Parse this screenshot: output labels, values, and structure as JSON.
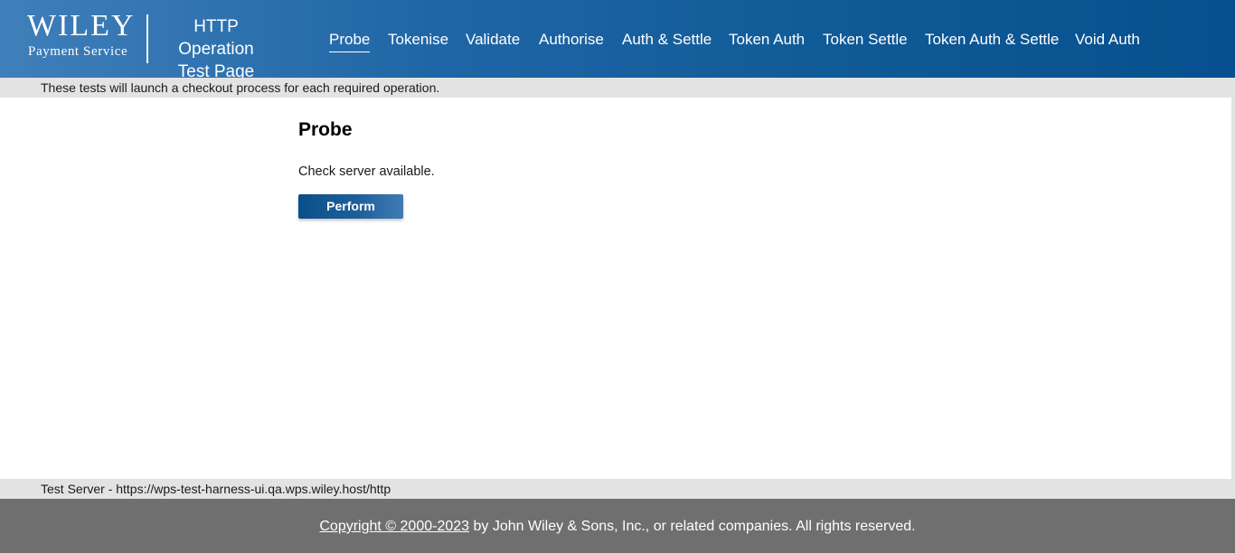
{
  "header": {
    "logo": {
      "brand": "WILEY",
      "subtitle": "Payment Service"
    },
    "page_heading_line1": "HTTP Operation",
    "page_heading_line2": "Test Page",
    "accent_color": "#1f66a6"
  },
  "nav": {
    "items": [
      {
        "label": "Probe",
        "active": true
      },
      {
        "label": "Tokenise",
        "active": false
      },
      {
        "label": "Validate",
        "active": false
      },
      {
        "label": "Authorise",
        "active": false
      },
      {
        "label": "Auth & Settle",
        "active": false
      },
      {
        "label": "Token Auth",
        "active": false
      },
      {
        "label": "Token Settle",
        "active": false
      },
      {
        "label": "Token Auth & Settle",
        "active": false
      },
      {
        "label": "Void Auth",
        "active": false
      }
    ]
  },
  "info_bar": {
    "text": "These tests will launch a checkout process for each required operation."
  },
  "main": {
    "title": "Probe",
    "description": "Check server available.",
    "perform_label": "Perform"
  },
  "server_bar": {
    "text": "Test Server - https://wps-test-harness-ui.qa.wps.wiley.host/http"
  },
  "footer": {
    "copyright_link": "Copyright © 2000-2023",
    "copyright_rest": " by John Wiley & Sons, Inc., or related companies. All rights reserved."
  }
}
